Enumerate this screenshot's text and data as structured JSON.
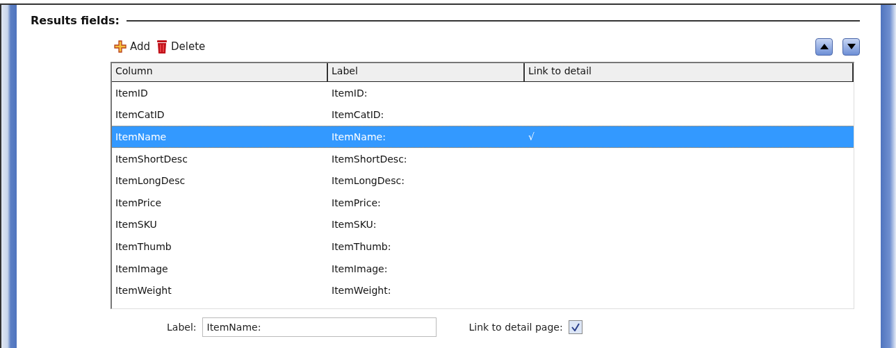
{
  "section_title": "Results fields:",
  "toolbar": {
    "add": "Add",
    "delete": "Delete"
  },
  "table": {
    "columns": [
      "Column",
      "Label",
      "Link to detail"
    ],
    "rows": [
      {
        "column": "ItemID",
        "label": "ItemID:",
        "selected": false
      },
      {
        "column": "ItemCatID",
        "label": "ItemCatID:",
        "selected": false
      },
      {
        "column": "ItemName",
        "label": "ItemName:",
        "link": "√",
        "selected": true
      },
      {
        "column": "ItemShortDesc",
        "label": "ItemShortDesc:",
        "selected": false
      },
      {
        "column": "ItemLongDesc",
        "label": "ItemLongDesc:",
        "selected": false
      },
      {
        "column": "ItemPrice",
        "label": "ItemPrice:",
        "selected": false
      },
      {
        "column": "ItemSKU",
        "label": "ItemSKU:",
        "selected": false
      },
      {
        "column": "ItemThumb",
        "label": "ItemThumb:",
        "selected": false
      },
      {
        "column": "ItemImage",
        "label": "ItemImage:",
        "selected": false
      },
      {
        "column": "ItemWeight",
        "label": "ItemWeight:",
        "selected": false
      }
    ]
  },
  "form": {
    "label_caption": "Label:",
    "label_value": "ItemName:",
    "link_caption": "Link to detail page:",
    "link_checked": true
  }
}
